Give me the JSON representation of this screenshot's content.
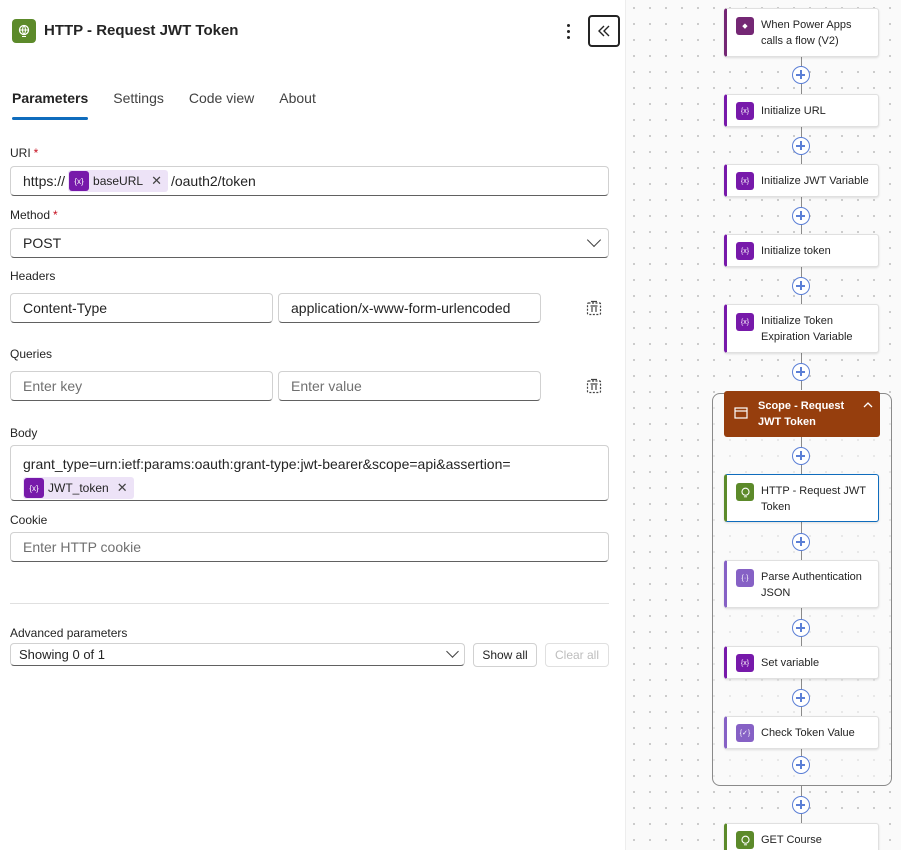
{
  "panel": {
    "title": "HTTP - Request JWT Token",
    "tabs": [
      "Parameters",
      "Settings",
      "Code view",
      "About"
    ],
    "uri": {
      "label": "URI",
      "required_mark": "*",
      "prefix": "https://",
      "token": "baseURL",
      "suffix": "/oauth2/token"
    },
    "method": {
      "label": "Method",
      "required_mark": "*",
      "value": "POST"
    },
    "headers": {
      "label": "Headers",
      "key": "Content-Type",
      "value": "application/x-www-form-urlencoded"
    },
    "queries": {
      "label": "Queries",
      "key_placeholder": "Enter key",
      "value_placeholder": "Enter value"
    },
    "body": {
      "label": "Body",
      "text": "grant_type=urn:ietf:params:oauth:grant-type:jwt-bearer&scope=api&assertion=",
      "token": "JWT_token"
    },
    "cookie": {
      "label": "Cookie",
      "placeholder": "Enter HTTP cookie"
    },
    "advanced": {
      "label": "Advanced parameters",
      "value": "Showing 0 of 1",
      "show_all": "Show all",
      "clear_all": "Clear all"
    },
    "token_icon_text": "{x}",
    "token_remove": "✕"
  },
  "flow": {
    "nodes": [
      {
        "label": "When Power Apps calls a flow (V2)",
        "icon": "power-apps-icon",
        "color": "#742774"
      },
      {
        "label": "Initialize URL",
        "icon": "variable-icon",
        "color": "#7719aa"
      },
      {
        "label": "Initialize JWT Variable",
        "icon": "variable-icon",
        "color": "#7719aa"
      },
      {
        "label": "Initialize token",
        "icon": "variable-icon",
        "color": "#7719aa"
      },
      {
        "label": "Initialize Token Expiration Variable",
        "icon": "variable-icon",
        "color": "#7719aa"
      },
      {
        "label": "HTTP - Request JWT Token",
        "icon": "http-globe-icon",
        "color": "#5c8a2a"
      },
      {
        "label": "Parse Authentication JSON",
        "icon": "parse-json-icon",
        "color": "#8661c5"
      },
      {
        "label": "Set variable",
        "icon": "variable-icon",
        "color": "#7719aa"
      },
      {
        "label": "Check Token Value",
        "icon": "condition-icon",
        "color": "#8661c5"
      },
      {
        "label": "GET Course",
        "icon": "http-globe-icon",
        "color": "#5c8a2a"
      }
    ],
    "scope": {
      "label": "Scope - Request JWT Token",
      "color": "#963e0d"
    },
    "var_icon_text": "{x}"
  },
  "colors": {
    "accent": "#0f6cbd",
    "http": "#5c8a2a",
    "variable": "#7719aa",
    "scope": "#963e0d"
  }
}
